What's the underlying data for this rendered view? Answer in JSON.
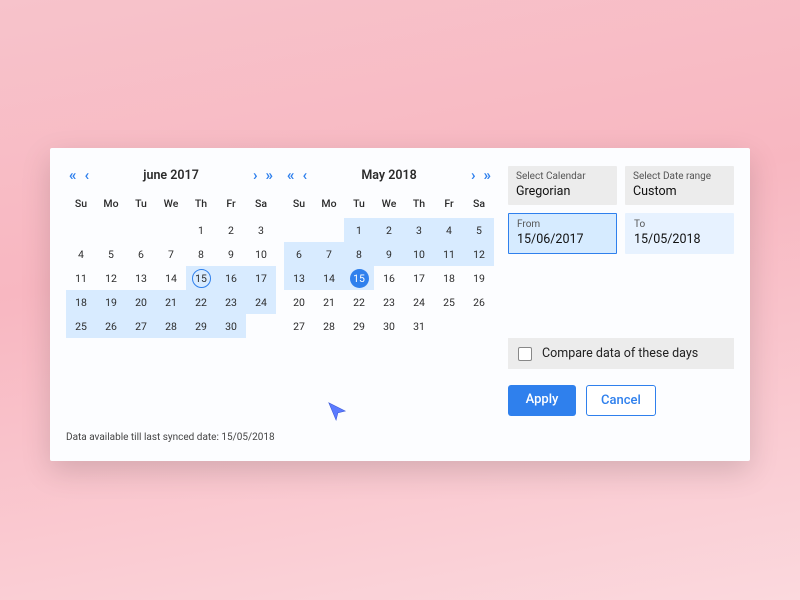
{
  "colors": {
    "accent": "#2f80ed"
  },
  "calendar_left": {
    "title": "june 2017",
    "dow": [
      "Su",
      "Mo",
      "Tu",
      "We",
      "Th",
      "Fr",
      "Sa"
    ],
    "offset": 4,
    "days_in_month": 30,
    "range_start": 15,
    "range_end": 30,
    "ring_day": 15
  },
  "calendar_right": {
    "title": "May 2018",
    "dow": [
      "Su",
      "Mo",
      "Tu",
      "We",
      "Th",
      "Fr",
      "Sa"
    ],
    "offset": 2,
    "days_in_month": 31,
    "range_start": 1,
    "range_end": 15,
    "fill_day": 15
  },
  "sidebar": {
    "calendar_label": "Select Calendar",
    "calendar_value": "Gregorian",
    "range_label": "Select Date range",
    "range_value": "Custom",
    "from_label": "From",
    "from_value": "15/06/2017",
    "to_label": "To",
    "to_value": "15/05/2018",
    "compare_label": "Compare data of these days",
    "apply": "Apply",
    "cancel": "Cancel"
  },
  "footnote": "Data available till last synced date: 15/05/2018"
}
